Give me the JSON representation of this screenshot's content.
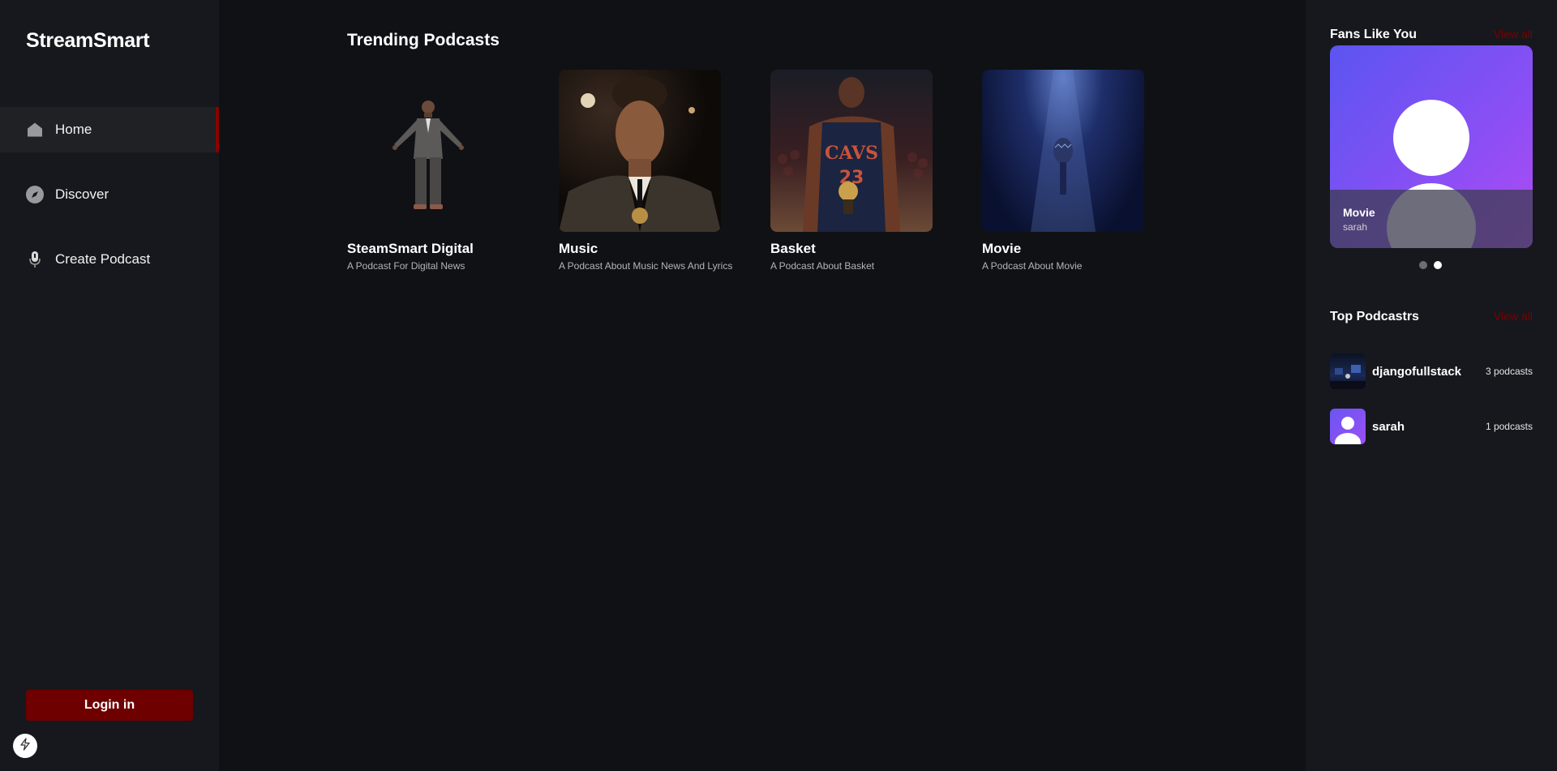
{
  "app": {
    "name": "StreamSmart"
  },
  "sidebar": {
    "items": [
      {
        "label": "Home",
        "icon": "home-icon",
        "active": true
      },
      {
        "label": "Discover",
        "icon": "compass-icon",
        "active": false
      },
      {
        "label": "Create Podcast",
        "icon": "microphone-icon",
        "active": false
      }
    ],
    "login_label": "Login in"
  },
  "main": {
    "section_title": "Trending Podcasts",
    "podcasts": [
      {
        "title": "SteamSmart Digital",
        "description": "A Podcast For Digital News"
      },
      {
        "title": "Music",
        "description": "A Podcast About Music News And Lyrics"
      },
      {
        "title": "Basket",
        "description": "A Podcast About Basket"
      },
      {
        "title": "Movie",
        "description": "A Podcast About Movie"
      }
    ]
  },
  "right_panel": {
    "fans": {
      "title": "Fans Like You",
      "view_all": "View all",
      "card": {
        "title": "Movie",
        "author": "sarah"
      }
    },
    "top": {
      "title": "Top Podcastrs",
      "view_all": "View all",
      "podcasters": [
        {
          "name": "djangofullstack",
          "count": "3 podcasts"
        },
        {
          "name": "sarah",
          "count": "1 podcasts"
        }
      ]
    }
  },
  "colors": {
    "accent": "#6e0000",
    "active_indicator": "#8b0000",
    "sidebar_bg": "#16181d",
    "main_bg": "#101114"
  }
}
